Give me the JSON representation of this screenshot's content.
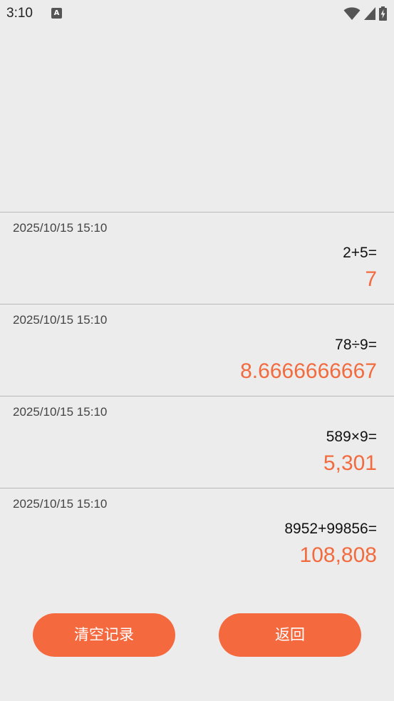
{
  "status_bar": {
    "time": "3:10",
    "notification_badge": "A",
    "icons": [
      "wifi-icon",
      "signal-icon",
      "battery-charging-icon"
    ]
  },
  "history": [
    {
      "timestamp": "2025/10/15 15:10",
      "expression": "2+5=",
      "result": "7"
    },
    {
      "timestamp": "2025/10/15 15:10",
      "expression": "78÷9=",
      "result": "8.6666666667"
    },
    {
      "timestamp": "2025/10/15 15:10",
      "expression": "589×9=",
      "result": "5,301"
    },
    {
      "timestamp": "2025/10/15 15:10",
      "expression": "8952+99856=",
      "result": "108,808"
    }
  ],
  "actions": {
    "clear_label": "清空记录",
    "back_label": "返回"
  },
  "colors": {
    "accent": "#f5693f",
    "result_text": "#f26b3f",
    "background": "#ececec",
    "divider": "#b9b9b9"
  }
}
